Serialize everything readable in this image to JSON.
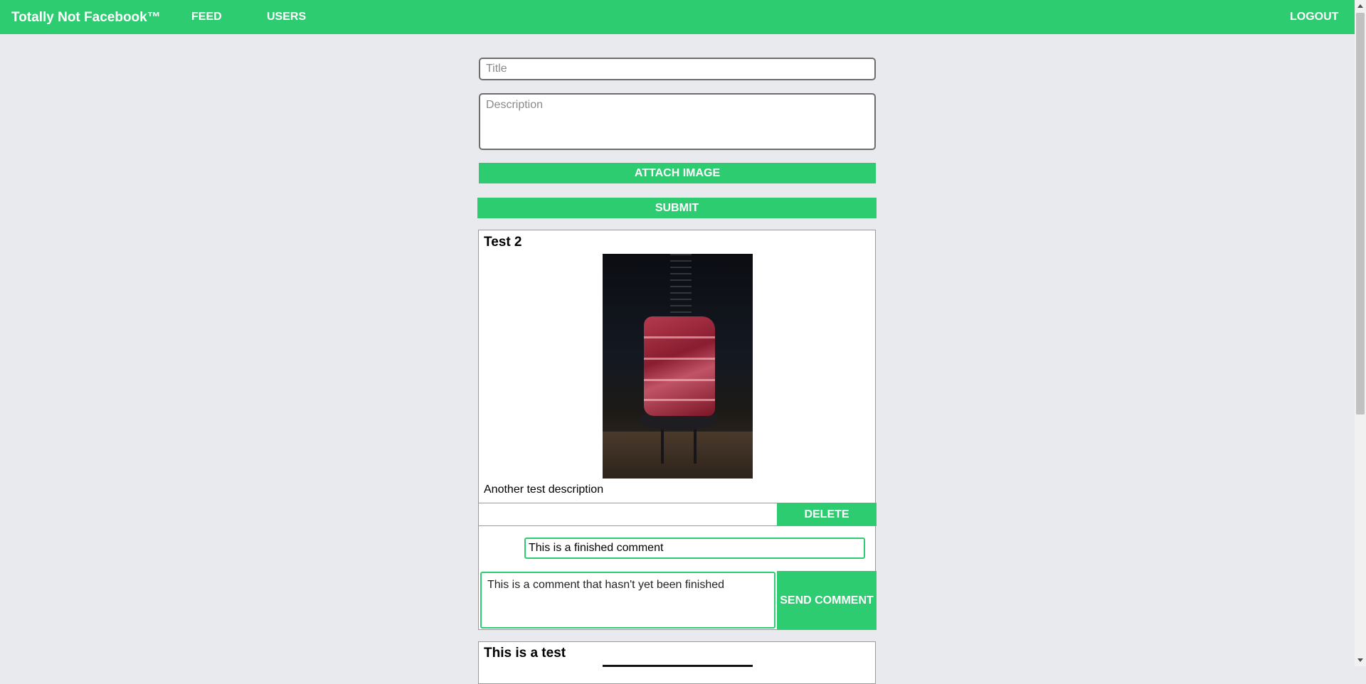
{
  "nav": {
    "brand": "Totally Not Facebook™",
    "feed": "FEED",
    "users": "USERS",
    "logout": "LOGOUT"
  },
  "form": {
    "title_placeholder": "Title",
    "description_placeholder": "Description",
    "attach_label": "ATTACH IMAGE",
    "submit_label": "SUBMIT"
  },
  "posts": [
    {
      "title": "Test 2",
      "description": "Another test description",
      "delete_label": "DELETE",
      "comments": [
        "This is a finished comment"
      ],
      "comment_draft": "This is a comment that hasn't yet been finished",
      "send_label": "SEND COMMENT"
    },
    {
      "title": "This is a test"
    }
  ],
  "colors": {
    "accent": "#2ecc71",
    "background": "#e9eaee"
  }
}
